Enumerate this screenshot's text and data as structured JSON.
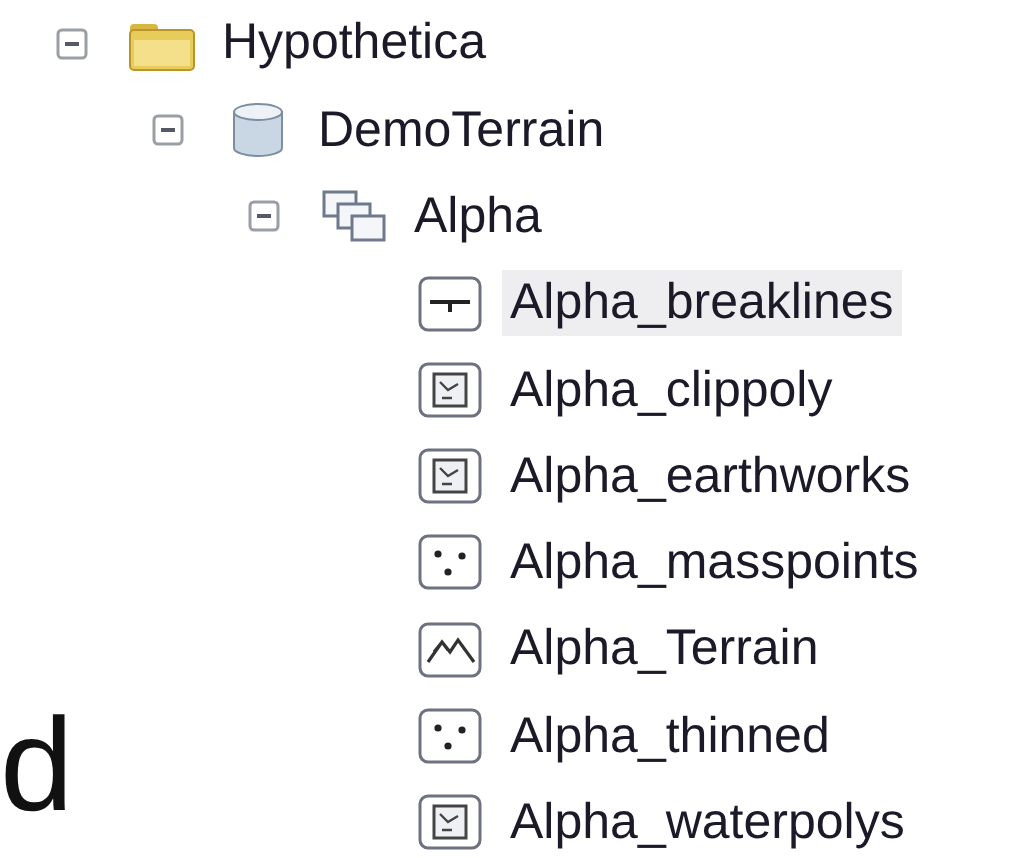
{
  "tree": [
    {
      "label": "Hypothetica",
      "kind": "folder",
      "expanded": true,
      "selected": false,
      "children": [
        {
          "label": "DemoTerrain",
          "kind": "database",
          "expanded": true,
          "selected": false,
          "children": [
            {
              "label": "Alpha",
              "kind": "dataset",
              "expanded": true,
              "selected": false,
              "children": [
                {
                  "label": "Alpha_breaklines",
                  "kind": "line",
                  "selected": true
                },
                {
                  "label": "Alpha_clippoly",
                  "kind": "polygon",
                  "selected": false
                },
                {
                  "label": "Alpha_earthworks",
                  "kind": "polygon",
                  "selected": false
                },
                {
                  "label": "Alpha_masspoints",
                  "kind": "points",
                  "selected": false
                },
                {
                  "label": "Alpha_Terrain",
                  "kind": "terrain",
                  "selected": false
                },
                {
                  "label": "Alpha_thinned",
                  "kind": "points",
                  "selected": false
                },
                {
                  "label": "Alpha_waterpolys",
                  "kind": "polygon",
                  "selected": false
                }
              ]
            }
          ]
        }
      ]
    }
  ],
  "fragment": "d"
}
